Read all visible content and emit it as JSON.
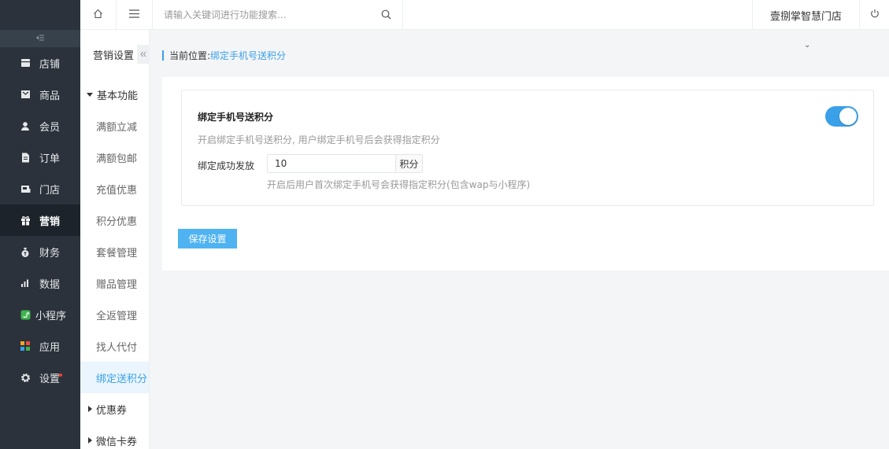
{
  "sidebar": {
    "items": [
      {
        "label": "店铺",
        "icon": "store-icon"
      },
      {
        "label": "商品",
        "icon": "goods-icon"
      },
      {
        "label": "会员",
        "icon": "member-icon"
      },
      {
        "label": "订单",
        "icon": "order-icon"
      },
      {
        "label": "门店",
        "icon": "shop-icon"
      },
      {
        "label": "营销",
        "icon": "gift-icon",
        "active": true
      },
      {
        "label": "财务",
        "icon": "money-bag-icon"
      },
      {
        "label": "数据",
        "icon": "bar-chart-icon"
      },
      {
        "label": "小程序",
        "icon": "mini-program-icon"
      },
      {
        "label": "应用",
        "icon": "apps-icon"
      },
      {
        "label": "设置",
        "icon": "gear-icon"
      }
    ]
  },
  "submenu": {
    "title": "营销设置",
    "group_basic": "基本功能",
    "items": [
      "满额立减",
      "满额包邮",
      "充值优惠",
      "积分优惠",
      "套餐管理",
      "赠品管理",
      "全返管理",
      "找人代付",
      "绑定送积分"
    ],
    "group_coupon": "优惠券",
    "group_wxcard": "微信卡券"
  },
  "topbar": {
    "search_placeholder": "请输入关键词进行功能搜索...",
    "store_name": "壹捌掌智慧门店"
  },
  "breadcrumb": {
    "label": "当前位置:",
    "current": "绑定手机号送积分"
  },
  "settings": {
    "title": "绑定手机号送积分",
    "description": "开启绑定手机号送积分, 用户绑定手机号后会获得指定积分",
    "enabled": true,
    "field_label": "绑定成功发放",
    "field_value": "10",
    "field_unit": "积分",
    "field_help": "开启后用户首次绑定手机号会获得指定积分(包含wap与小程序)"
  },
  "save_button": "保存设置",
  "colors": {
    "sidebar_bg": "#2b323b",
    "accent": "#3aa0e8",
    "button": "#4fb3f2"
  }
}
